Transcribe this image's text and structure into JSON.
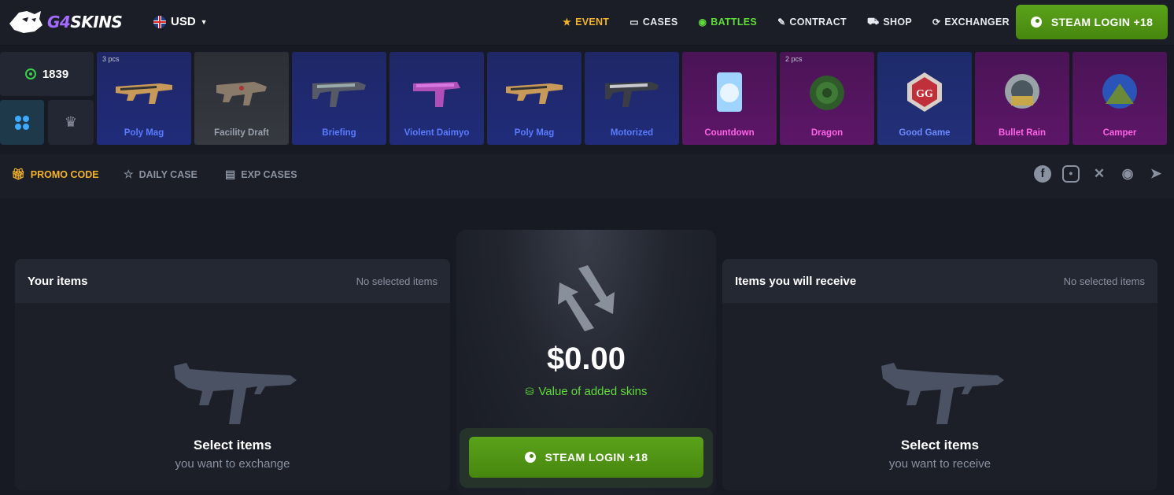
{
  "header": {
    "logo_text_a": "G4",
    "logo_text_b": "SKINS",
    "currency": "USD",
    "nav": [
      {
        "label": "EVENT",
        "icon": "star-icon"
      },
      {
        "label": "CASES",
        "icon": "cases-icon"
      },
      {
        "label": "BATTLES",
        "icon": "battles-icon"
      },
      {
        "label": "CONTRACT",
        "icon": "contract-icon"
      },
      {
        "label": "SHOP",
        "icon": "cart-icon"
      },
      {
        "label": "EXCHANGER",
        "icon": "exchange-icon"
      }
    ],
    "login_label": "STEAM LOGIN +18"
  },
  "live": {
    "online_count": "1839",
    "drops": [
      {
        "name": "Poly Mag",
        "count": "3 pcs",
        "rarity": "blue"
      },
      {
        "name": "Facility Draft",
        "count": "",
        "rarity": "gray"
      },
      {
        "name": "Briefing",
        "count": "",
        "rarity": "blue"
      },
      {
        "name": "Violent Daimyo",
        "count": "",
        "rarity": "blue"
      },
      {
        "name": "Poly Mag",
        "count": "",
        "rarity": "blue"
      },
      {
        "name": "Motorized",
        "count": "",
        "rarity": "blue"
      },
      {
        "name": "Countdown",
        "count": "",
        "rarity": "magenta"
      },
      {
        "name": "Dragon",
        "count": "2 pcs",
        "rarity": "magenta"
      },
      {
        "name": "Good Game",
        "count": "",
        "rarity": "darkblue"
      },
      {
        "name": "Bullet Rain",
        "count": "",
        "rarity": "magenta"
      },
      {
        "name": "Camper",
        "count": "",
        "rarity": "magenta"
      }
    ]
  },
  "subnav": {
    "promo": "PROMO CODE",
    "daily": "DAILY CASE",
    "exp": "EXP CASES",
    "socials": [
      "facebook-icon",
      "instagram-icon",
      "x-icon",
      "discord-icon",
      "telegram-icon"
    ]
  },
  "exchanger": {
    "left_title": "Your items",
    "left_status": "No selected items",
    "left_main": "Select items",
    "left_sub": "you want to exchange",
    "right_title": "Items you will receive",
    "right_status": "No selected items",
    "right_main": "Select items",
    "right_sub": "you want to receive",
    "amount": "$0.00",
    "value_label": "Value of added skins",
    "login_label": "STEAM LOGIN +18"
  },
  "colors": {
    "accent_green": "#5aa31a",
    "event_gold": "#f3b32a",
    "battles_green": "#5fdc3a",
    "brand_purple": "#a36bff"
  }
}
